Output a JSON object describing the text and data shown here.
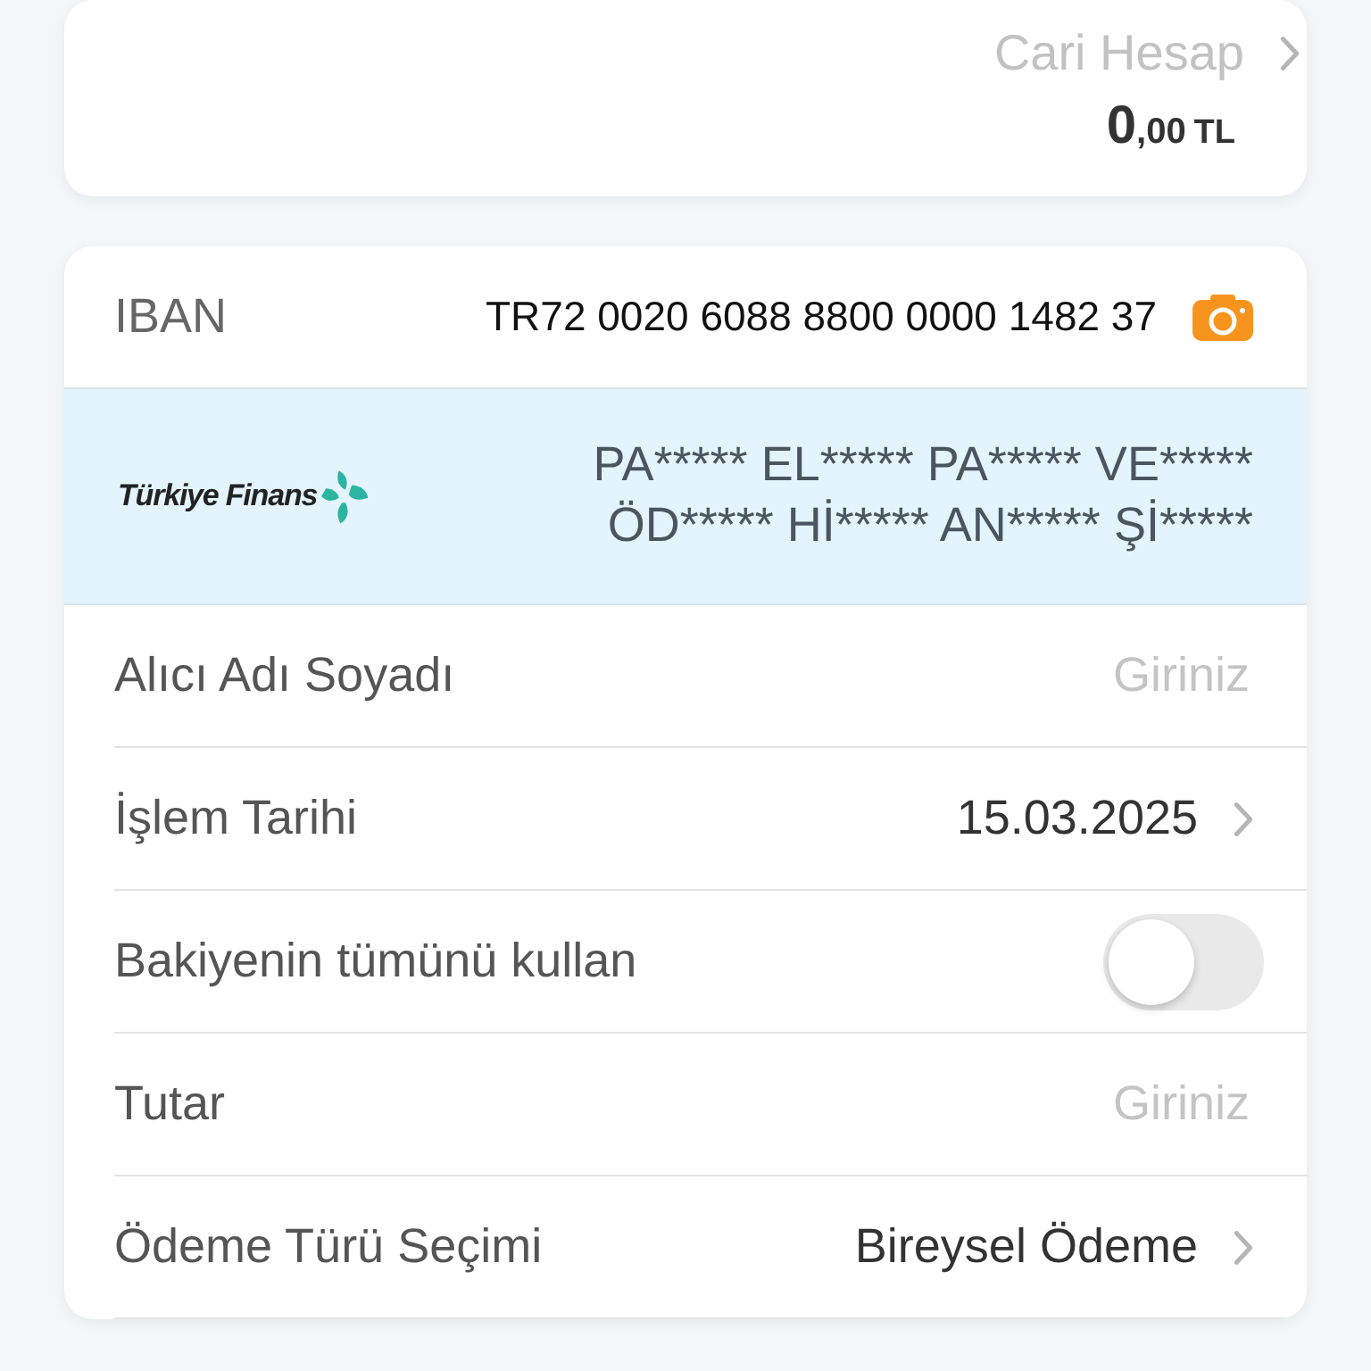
{
  "account": {
    "type": "Cari Hesap",
    "balance_integer": "0",
    "balance_fraction": ",00",
    "currency": "TL"
  },
  "iban": {
    "label": "IBAN",
    "value": "TR72 0020 6088 8800 0000 1482 37"
  },
  "bank": {
    "name": "Türkiye Finans",
    "holder_lines": [
      "PA***** EL***** PA***** VE*****",
      "ÖD***** Hİ***** AN***** Şİ*****"
    ]
  },
  "rows": [
    {
      "kind": "input",
      "label": "Alıcı Adı Soyadı",
      "placeholder": "Giriniz"
    },
    {
      "kind": "select",
      "label": "İşlem Tarihi",
      "value": "15.03.2025"
    },
    {
      "kind": "toggle",
      "label": "Bakiyenin tümünü kullan",
      "on": false
    },
    {
      "kind": "input",
      "label": "Tutar",
      "placeholder": "Giriniz"
    },
    {
      "kind": "select",
      "label": "Ödeme Türü Seçimi",
      "value": "Bireysel Ödeme"
    }
  ]
}
